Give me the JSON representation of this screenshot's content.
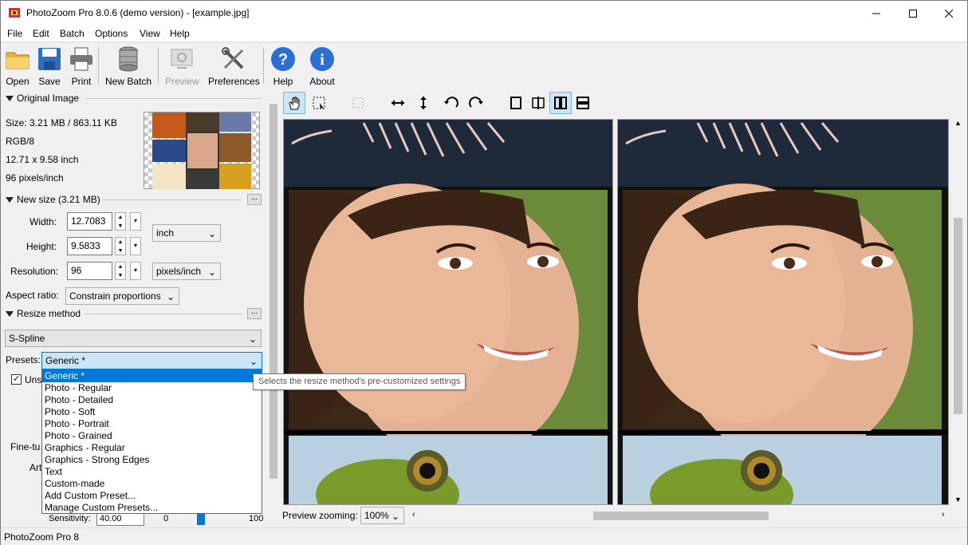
{
  "window": {
    "title": "PhotoZoom Pro 8.0.6 (demo version) - [example.jpg]"
  },
  "menu": [
    "File",
    "Edit",
    "Batch",
    "Options",
    "View",
    "Help"
  ],
  "toolbar": {
    "open": "Open",
    "save": "Save",
    "print": "Print",
    "new_batch": "New Batch",
    "preview": "Preview",
    "preferences": "Preferences",
    "help": "Help",
    "about": "About"
  },
  "original": {
    "header": "Original Image",
    "size": "Size: 3.21 MB / 863.11 KB",
    "mode": "RGB/8",
    "dims": "12.71 x 9.58 inch",
    "ppi": "96 pixels/inch"
  },
  "newsize": {
    "header": "New size (3.21 MB)",
    "width_label": "Width:",
    "width": "12.7083",
    "height_label": "Height:",
    "height": "9.5833",
    "res_label": "Resolution:",
    "res": "96",
    "unit": "inch",
    "res_unit": "pixels/inch",
    "aspect_label": "Aspect ratio:",
    "aspect": "Constrain proportions",
    "dots": "..."
  },
  "resize": {
    "header": "Resize method",
    "method": "S-Spline",
    "presets_label": "Presets:",
    "preset": "Generic *",
    "options": [
      "Generic *",
      "Photo - Regular",
      "Photo - Detailed",
      "Photo - Soft",
      "Photo - Portrait",
      "Photo - Grained",
      "Graphics - Regular",
      "Graphics - Strong Edges",
      "Text",
      "Custom-made",
      "Add Custom Preset...",
      "Manage Custom Presets..."
    ],
    "tooltip": "Selects the resize method's pre-customized settings",
    "unsharp_partial": "Uns",
    "finetune_partial": "Fine-tu",
    "art_partial": "Art",
    "sensitivity_label": "Sensitivity:",
    "sensitivity": "40.00",
    "slider_min": "0",
    "slider_max": "100"
  },
  "preview": {
    "zoom_label": "Preview zooming:",
    "zoom": "100%"
  },
  "status": "PhotoZoom Pro 8"
}
